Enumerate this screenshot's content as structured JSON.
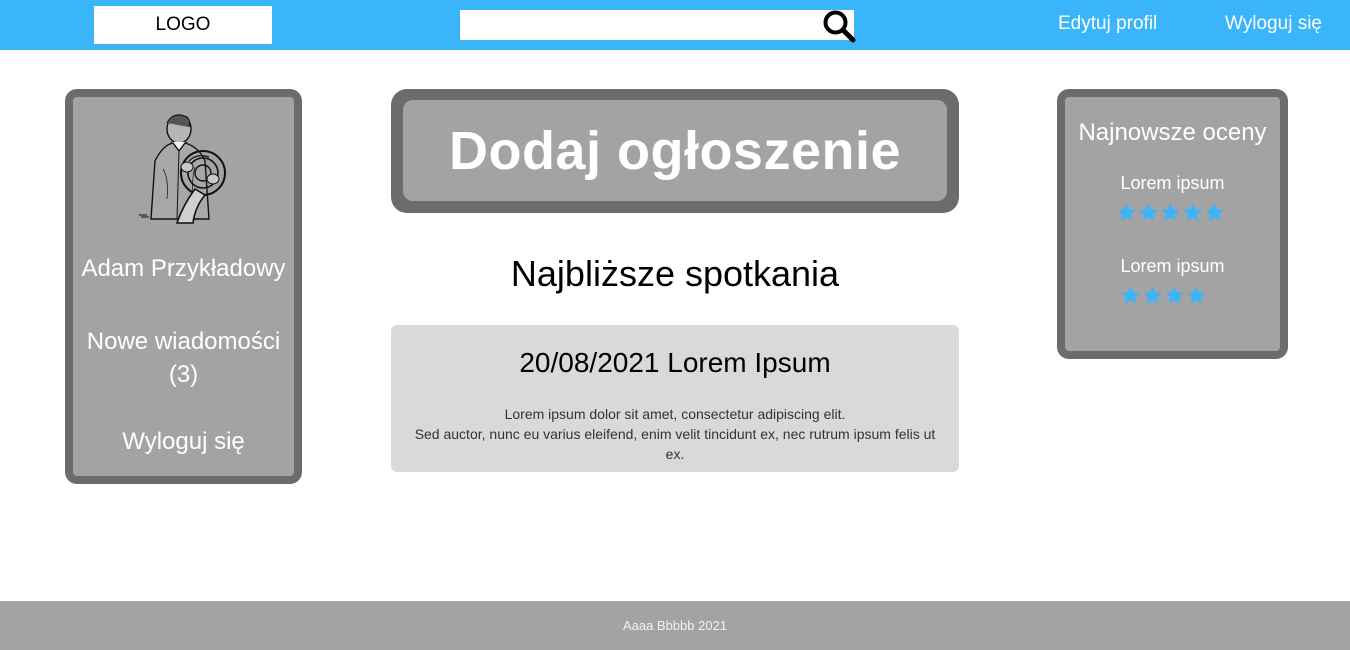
{
  "header": {
    "logo": "LOGO",
    "search": {
      "value": "",
      "placeholder": "",
      "icon": "search-icon"
    },
    "nav": {
      "edit_profile": "Edytuj profil",
      "logout": "Wyloguj się"
    },
    "color": "#3bb5fa"
  },
  "profile": {
    "avatar_icon": "horn-player-avatar",
    "name": "Adam Przykładowy",
    "messages_label": "Nowe wiadomości",
    "messages_count": "(3)",
    "logout": "Wyloguj się"
  },
  "main": {
    "add_button": "Dodaj ogłoszenie",
    "section_title": "Najbliższe spotkania",
    "meetings": [
      {
        "title": "20/08/2021 Lorem Ipsum",
        "description_line1": "Lorem ipsum dolor sit amet, consectetur adipiscing elit.",
        "description_line2": "Sed auctor, nunc eu varius eleifend, enim velit tincidunt ex, nec rutrum ipsum felis ut ex."
      }
    ]
  },
  "ratings": {
    "title": "Najnowsze oceny",
    "items": [
      {
        "name": "Lorem ipsum",
        "stars": 5
      },
      {
        "name": "Lorem ipsum",
        "stars": 4
      }
    ],
    "star_color": "#3bb5fa"
  },
  "footer": {
    "text": "Aaaa Bbbbb 2021"
  }
}
